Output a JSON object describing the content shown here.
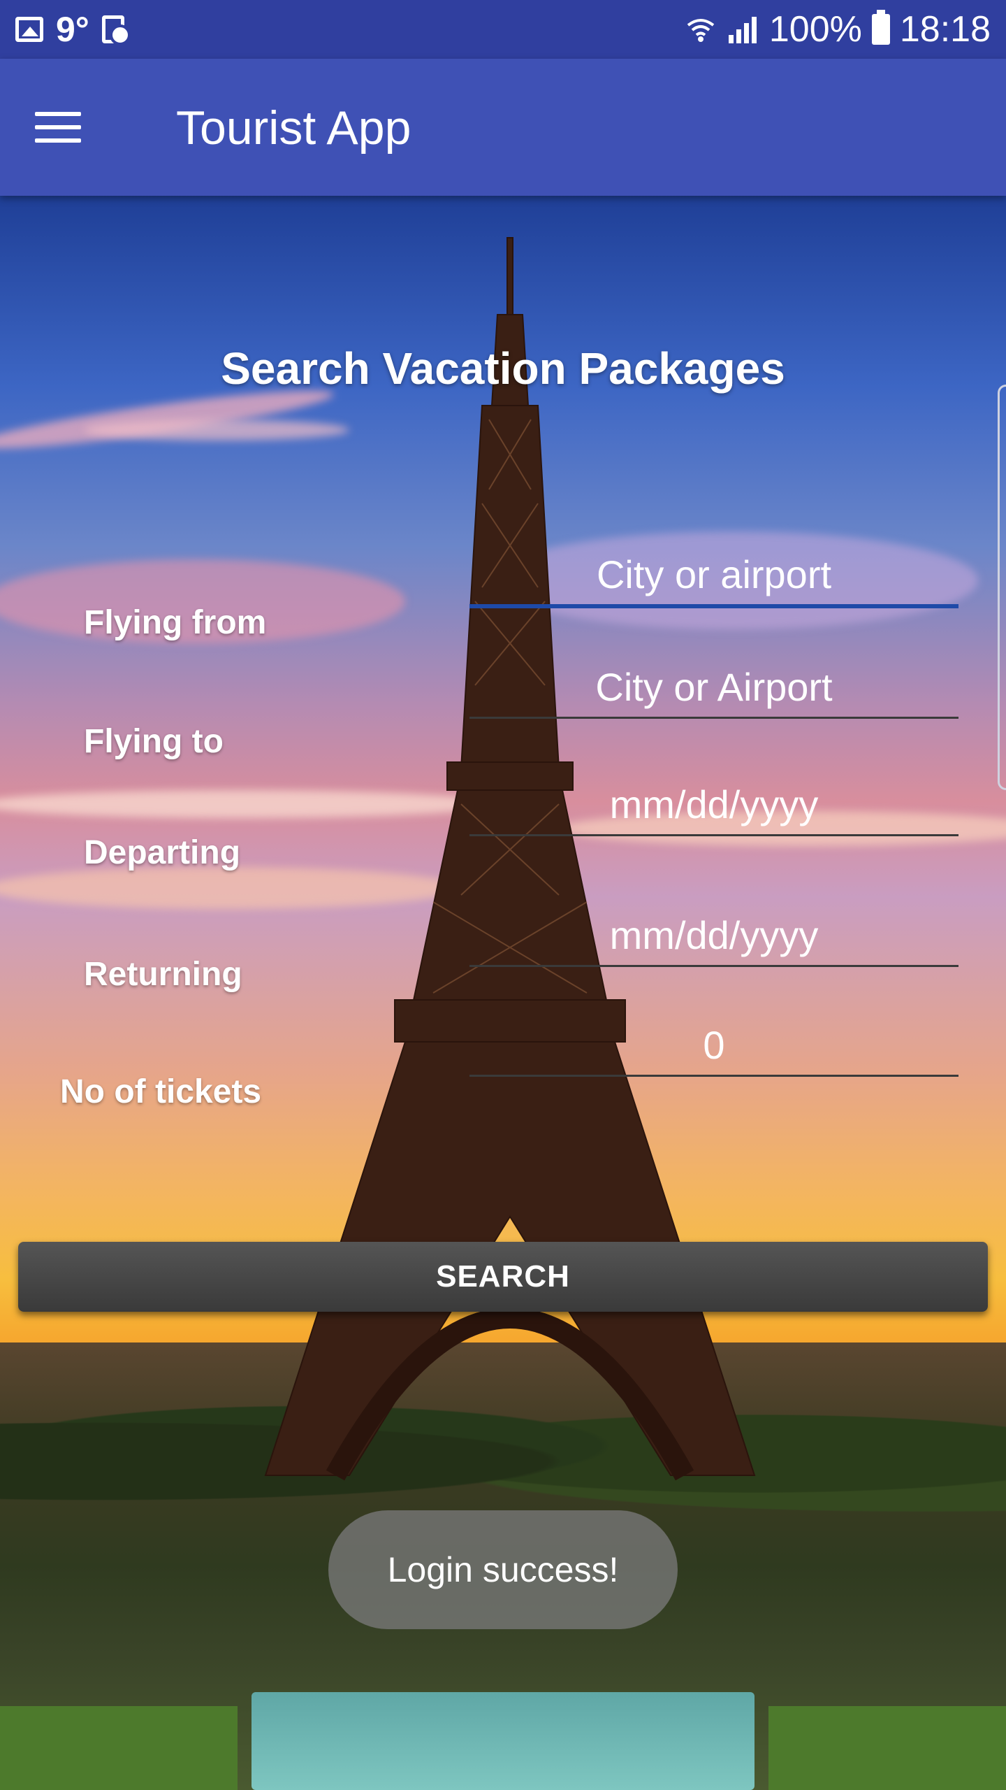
{
  "status_bar": {
    "temperature": "9°",
    "battery": "100%",
    "time": "18:18",
    "icons": [
      "gallery-icon",
      "clock-doc-icon",
      "wifi-icon",
      "signal-icon",
      "battery-icon"
    ]
  },
  "app_bar": {
    "title": "Tourist App",
    "menu_icon": "hamburger-menu-icon"
  },
  "form": {
    "title": "Search Vacation Packages",
    "fields": [
      {
        "label": "Flying from",
        "value": "City or airport"
      },
      {
        "label": "Flying to",
        "value": "City or Airport"
      },
      {
        "label": "Departing",
        "value": "mm/dd/yyyy"
      },
      {
        "label": "Returning",
        "value": "mm/dd/yyyy"
      },
      {
        "label": "No of tickets",
        "value": "0"
      }
    ],
    "search_label": "SEARCH"
  },
  "toast": {
    "message": "Login success!"
  },
  "colors": {
    "status_bar": "#303f9f",
    "app_bar": "#3f51b5",
    "active_underline": "#1e4aa8",
    "button": "#3a3a3a"
  }
}
